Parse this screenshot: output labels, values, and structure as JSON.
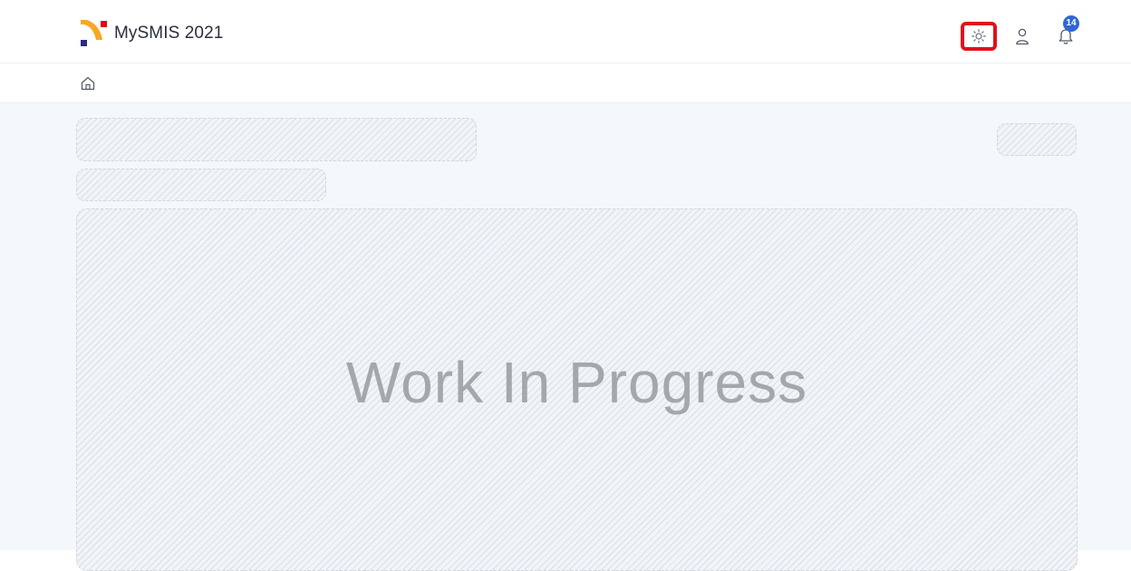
{
  "header": {
    "app_title": "MySMIS 2021",
    "logo_colors": {
      "orange": "#f7a823",
      "red": "#e30613",
      "navy": "#2b2a8c"
    },
    "actions": {
      "theme_icon": "sun-icon",
      "user_icon": "user-icon",
      "notifications_icon": "bell-icon",
      "notifications_count": "14",
      "badge_color": "#2f67d6",
      "highlight_color": "#e0111b"
    }
  },
  "breadcrumb": {
    "home_icon": "home-icon"
  },
  "main": {
    "placeholder_text": "Work In Progress"
  }
}
